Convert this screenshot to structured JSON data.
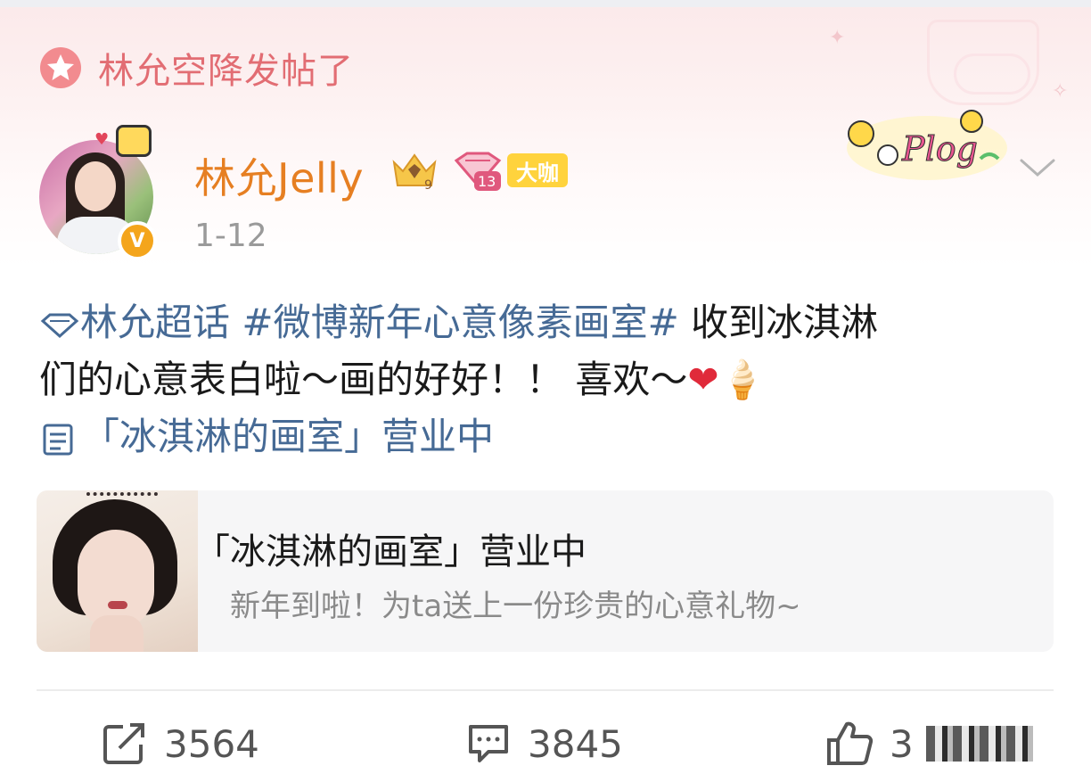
{
  "header": {
    "airdrop_text": "林允空降发帖了"
  },
  "post": {
    "username": "林允Jelly",
    "crown_level": "9",
    "member_level": "13",
    "badge_label": "大咖",
    "sticker_text": "Plog",
    "date": "1-12",
    "text": {
      "supertopic": "林允超话",
      "hashtag": "#微博新年心意像素画室#",
      "body_line1_tail": " 收到冰淇淋",
      "body_line2": "们的心意表白啦～画的好好！！ 喜欢～",
      "heart_emoji": "❤",
      "icecream_emoji": "🍦",
      "link_text": "「冰淇淋的画室」营业中"
    },
    "card": {
      "title": "「冰淇淋的画室」营业中",
      "subtitle": "新年到啦！为ta送上一份珍贵的心意礼物~"
    },
    "actions": {
      "repost_count": "3564",
      "comment_count": "3845",
      "like_count_visible": "3"
    }
  },
  "colors": {
    "username": "#e67f22",
    "topic_link": "#466a95",
    "airdrop": "#e26d73",
    "badge": "#ffd33d"
  }
}
